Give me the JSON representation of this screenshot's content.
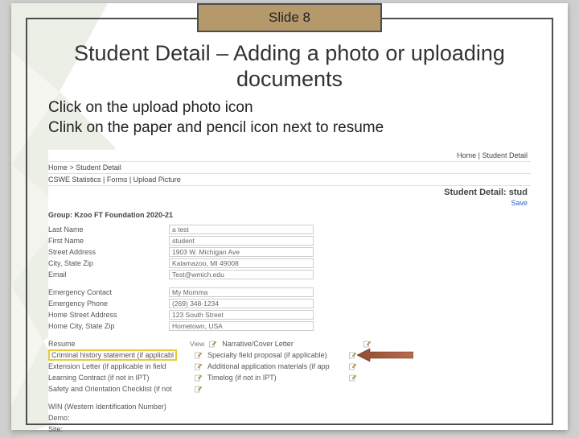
{
  "slide_label": "Slide 8",
  "title": "Student Detail – Adding a photo or uploading documents",
  "instructions": {
    "line1": "Click on the upload photo icon",
    "line2": "Clink on the paper and pencil icon next to resume"
  },
  "embed": {
    "crumb_top": "Home | Student Detail",
    "crumb_path": "Home > Student Detail",
    "tabstrip": "CSWE Statistics | Forms | Upload Picture",
    "header": "Student Detail: stud",
    "save": "Save",
    "group": "Group: Kzoo FT Foundation 2020-21",
    "fields": [
      {
        "lbl": "Last Name",
        "val": "a test"
      },
      {
        "lbl": "First Name",
        "val": "student"
      },
      {
        "lbl": "Street Address",
        "val": "1903 W. Michigan Ave"
      },
      {
        "lbl": "City, State Zip",
        "val": "Kalamazoo, MI 49008"
      },
      {
        "lbl": "Email",
        "val": "Test@wmich.edu"
      }
    ],
    "fields2": [
      {
        "lbl": "Emergency Contact",
        "val": "My Momma"
      },
      {
        "lbl": "Emergency Phone",
        "val": "(269) 348-1234"
      },
      {
        "lbl": "Home Street Address",
        "val": "123 South Street"
      },
      {
        "lbl": "Home City, State Zip",
        "val": "Hometown, USA"
      }
    ],
    "docs_left": [
      "Resume",
      "Criminal history statement (if applicabl",
      "Extension Letter (if applicable in field",
      "Learning Contract (if not in IPT)",
      "Safety and Orientation Checklist (if not"
    ],
    "docs_right": [
      "Narrative/Cover Letter",
      "Specialty field proposal (if applicable)",
      "Additional application materials (if app",
      "Timelog (if not in IPT)"
    ],
    "view": "View",
    "bottom_fields": [
      "WIN (Western Identification Number)",
      "Demo:",
      "Site:"
    ]
  }
}
